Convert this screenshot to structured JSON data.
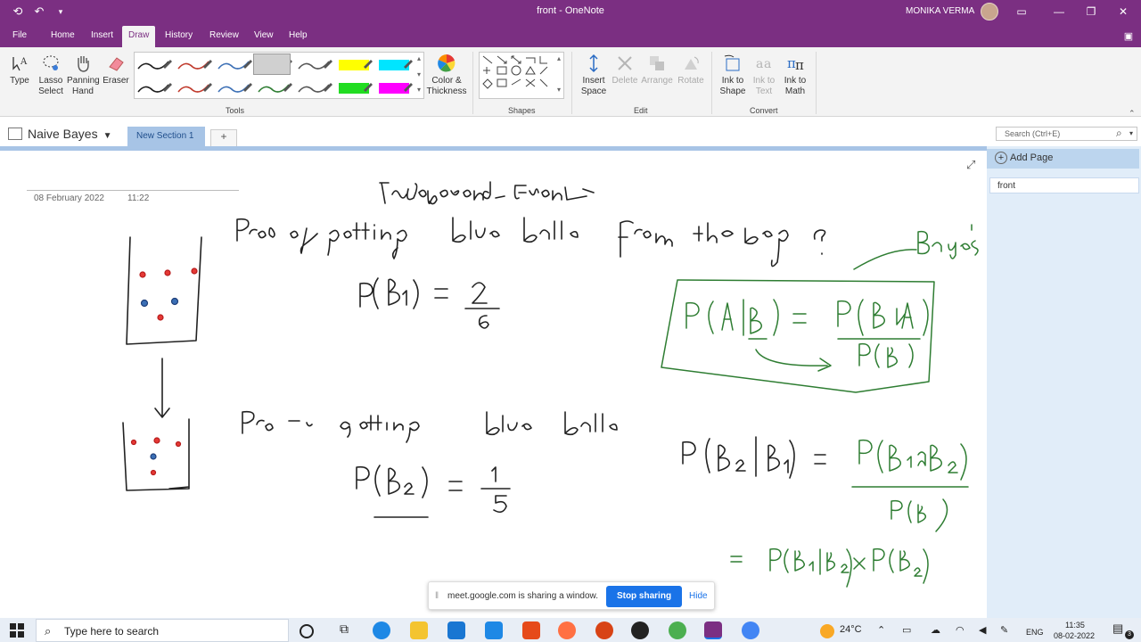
{
  "window": {
    "title": "front - OneNote",
    "user": "MONIKA VERMA"
  },
  "menu": [
    "File",
    "Home",
    "Insert",
    "Draw",
    "History",
    "Review",
    "View",
    "Help"
  ],
  "ribbon": {
    "type": "Type",
    "lasso": [
      "Lasso",
      "Select"
    ],
    "panning": [
      "Panning",
      "Hand"
    ],
    "eraser": "Eraser",
    "color_thickness": [
      "Color &",
      "Thickness"
    ],
    "insert_space": [
      "Insert",
      "Space"
    ],
    "delete": "Delete",
    "arrange": "Arrange",
    "rotate": "Rotate",
    "ink_to_shape": [
      "Ink to",
      "Shape"
    ],
    "ink_to_text": [
      "Ink to",
      "Text"
    ],
    "ink_to_math": [
      "Ink to",
      "Math"
    ],
    "groups": {
      "tools": "Tools",
      "shapes": "Shapes",
      "edit": "Edit",
      "convert": "Convert"
    },
    "pen_colors": [
      "#1b1b1b",
      "#c0392b",
      "#3b6fb5",
      "#2e7d32",
      "#555555",
      "#ffff00",
      "#00e5ff",
      "#1b1b1b",
      "#c0392b",
      "#3b6fb5",
      "#2e7d32",
      "#555555",
      "#22dd22",
      "#ff00ff"
    ]
  },
  "nav": {
    "notebook": "Naive Bayes",
    "section": "New Section 1",
    "add_section": "+",
    "search_placeholder": "Search (Ctrl+E)"
  },
  "sidebar": {
    "add_page": "Add Page",
    "pages": [
      "front"
    ]
  },
  "page": {
    "date": "08 February 2022",
    "time": "11:22"
  },
  "share_bar": {
    "message": "meet.google.com is sharing a window.",
    "stop": "Stop sharing",
    "hide": "Hide"
  },
  "taskbar": {
    "search": "Type here to search",
    "weather": "24°C",
    "lang": "ENG",
    "clock_time": "11:35",
    "clock_date": "08-02-2022",
    "notifications": "3"
  }
}
